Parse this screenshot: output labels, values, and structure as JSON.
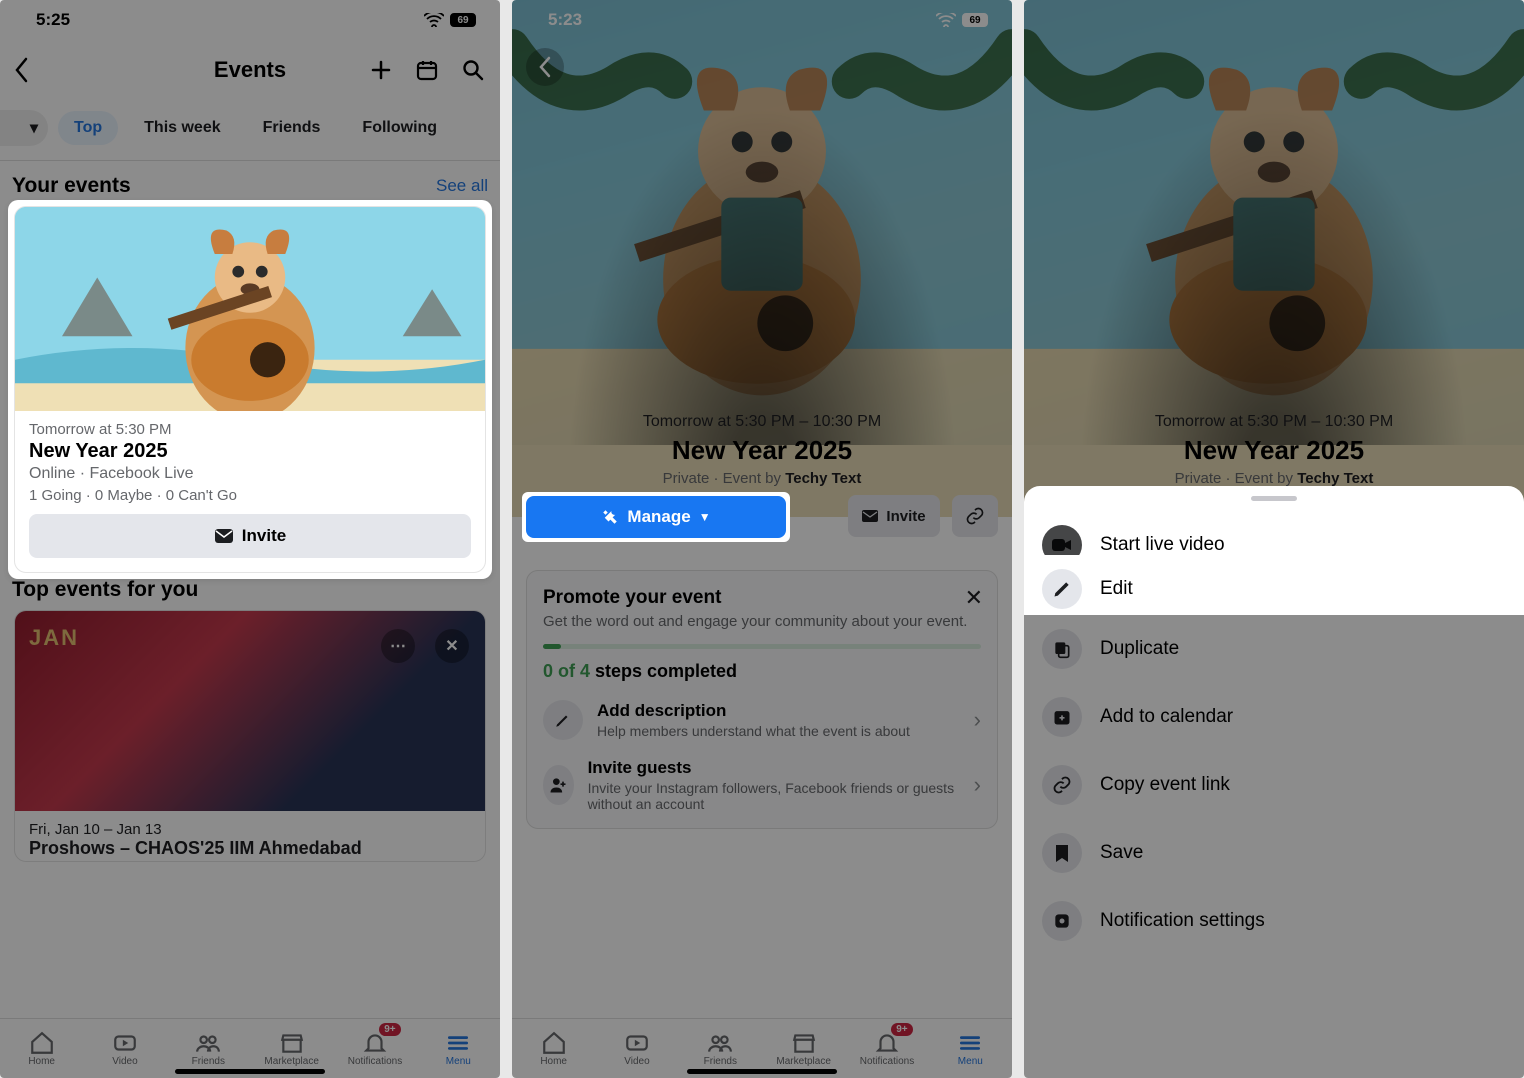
{
  "status": {
    "time1": "5:25",
    "time2": "5:23",
    "battery": "69"
  },
  "screen1": {
    "title": "Events",
    "chips": {
      "cut_caret": "▾",
      "top": "Top",
      "week": "This week",
      "friends": "Friends",
      "following": "Following"
    },
    "your_events": {
      "heading": "Your events",
      "see_all": "See all"
    },
    "card": {
      "when": "Tomorrow at 5:30 PM",
      "title": "New Year 2025",
      "location": "Online · Facebook Live",
      "stats": "1 Going · 0 Maybe · 0 Can't Go",
      "invite": "Invite"
    },
    "top_section": {
      "heading": "Top events for you"
    },
    "top_card": {
      "badge_month": "JAN",
      "date": "Fri, Jan 10 – Jan 13",
      "title": "Proshows – CHAOS'25 IIM Ahmedabad"
    },
    "tabs": {
      "home": "Home",
      "video": "Video",
      "friends": "Friends",
      "market": "Marketplace",
      "notif": "Notifications",
      "menu": "Menu",
      "badge": "9+"
    }
  },
  "screen2": {
    "when": "Tomorrow at 5:30 PM – 10:30 PM",
    "title": "New Year 2025",
    "by_prefix": "Private · Event by ",
    "by_name": "Techy Text",
    "manage": "Manage",
    "invite": "Invite",
    "promote": {
      "title": "Promote your event",
      "desc": "Get the word out and engage your community about your event.",
      "n": "0 of 4",
      "rest": " steps completed",
      "s1_title": "Add description",
      "s1_desc": "Help members understand what the event is about",
      "s2_title": "Invite guests",
      "s2_desc": "Invite your Instagram followers, Facebook friends or guests without an account"
    }
  },
  "screen3": {
    "when": "Tomorrow at 5:30 PM – 10:30 PM",
    "title": "New Year 2025",
    "by_prefix": "Private · Event by ",
    "by_name": "Techy Text",
    "items": {
      "live": "Start live video",
      "edit": "Edit",
      "dup": "Duplicate",
      "cal": "Add to calendar",
      "link": "Copy event link",
      "save": "Save",
      "notif": "Notification settings"
    }
  }
}
